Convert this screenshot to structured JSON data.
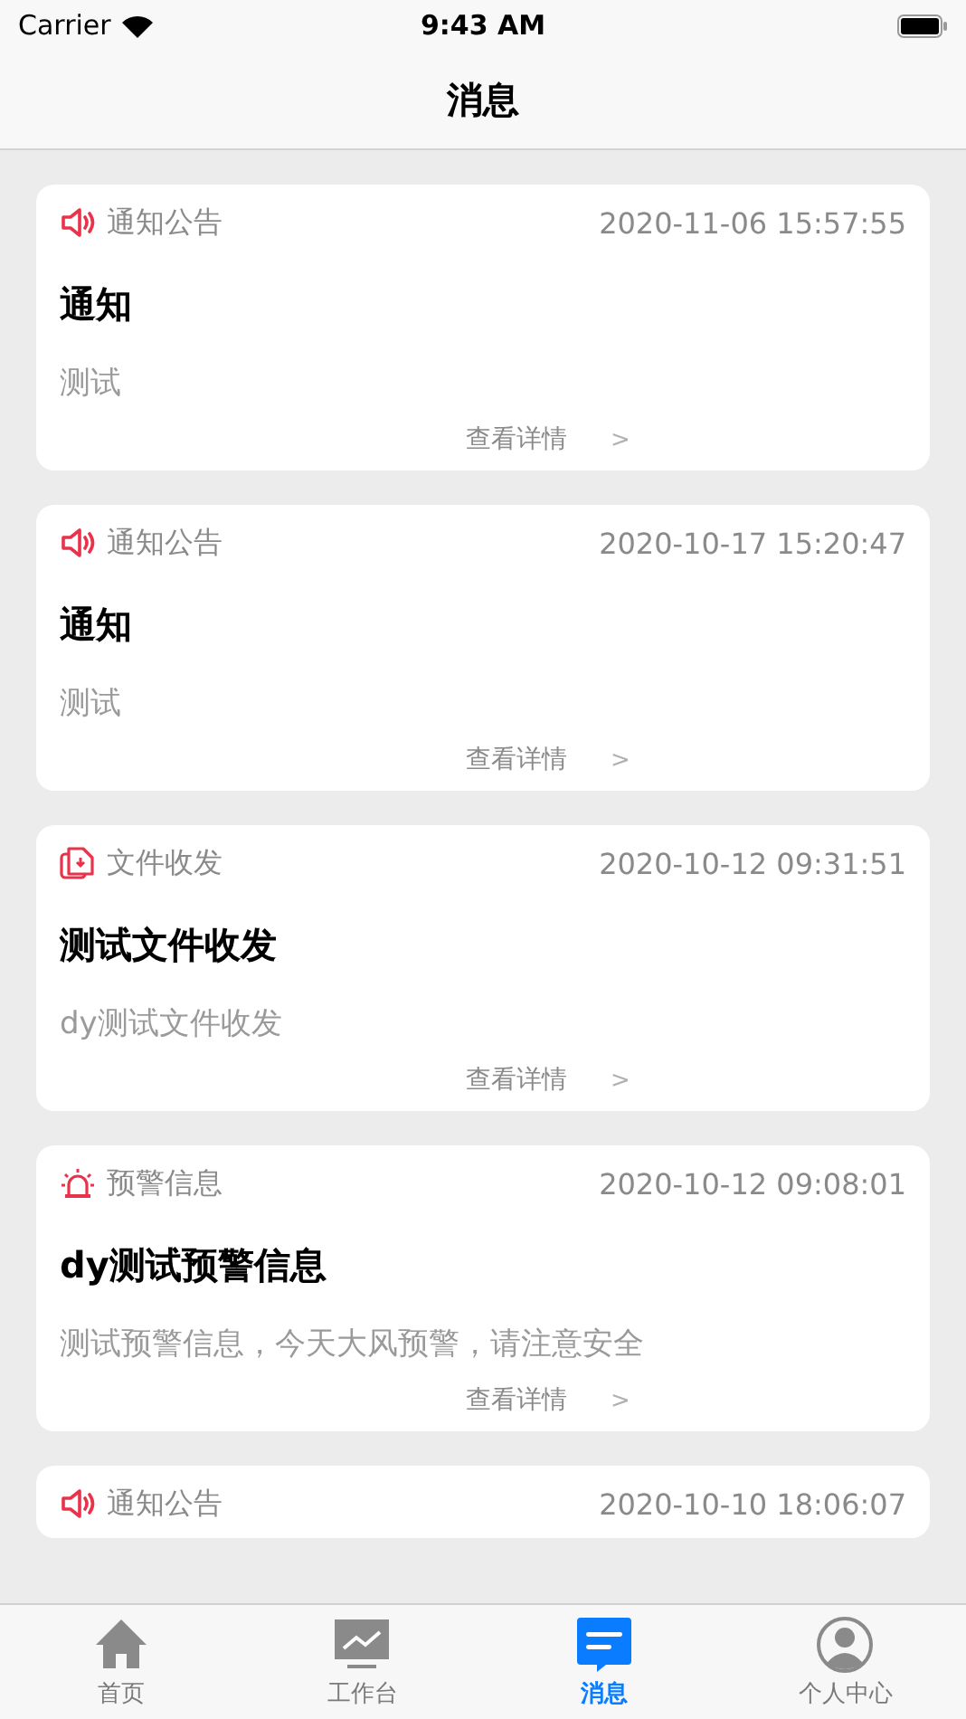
{
  "status_bar": {
    "carrier": "Carrier",
    "time": "9:43 AM"
  },
  "nav": {
    "title": "消息"
  },
  "messages": [
    {
      "kind": "notice",
      "category": "通知公告",
      "time": "2020-11-06 15:57:55",
      "title": "通知",
      "body": "测试",
      "link": "查看详情",
      "chevron": ">"
    },
    {
      "kind": "notice",
      "category": "通知公告",
      "time": "2020-10-17 15:20:47",
      "title": "通知",
      "body": "测试",
      "link": "查看详情",
      "chevron": ">"
    },
    {
      "kind": "file",
      "category": "文件收发",
      "time": "2020-10-12 09:31:51",
      "title": "测试文件收发",
      "body": "dy测试文件收发",
      "link": "查看详情",
      "chevron": ">"
    },
    {
      "kind": "alarm",
      "category": "预警信息",
      "time": "2020-10-12 09:08:01",
      "title": "dy测试预警信息",
      "body": "测试预警信息，今天大风预警，请注意安全",
      "link": "查看详情",
      "chevron": ">"
    },
    {
      "kind": "notice",
      "category": "通知公告",
      "time": "2020-10-10 18:06:07"
    }
  ],
  "tabs": [
    {
      "kind": "home",
      "label": "首页",
      "selected": false
    },
    {
      "kind": "chart",
      "label": "工作台",
      "selected": false
    },
    {
      "kind": "message",
      "label": "消息",
      "selected": true
    },
    {
      "kind": "person",
      "label": "个人中心",
      "selected": false
    }
  ]
}
